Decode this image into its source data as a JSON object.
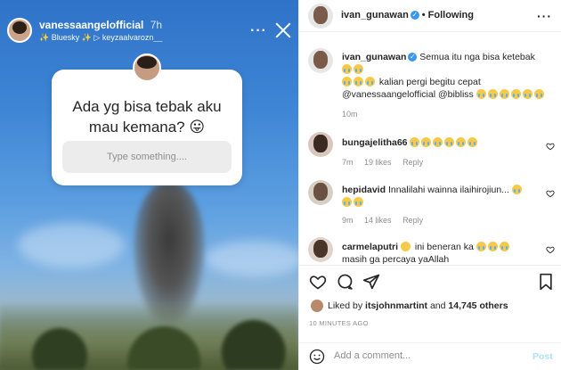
{
  "story": {
    "username": "vanessaangelofficial",
    "time": "7h",
    "music": "✨ Bluesky ✨ ▷ keyzaalvarozn__",
    "more_icon": "more-horizontal-icon",
    "close_icon": "close-icon",
    "question": "Ada yg bisa tebak aku mau kemana? 😛",
    "input_placeholder": "Type something...."
  },
  "post": {
    "author": "ivan_gunawan",
    "following_label": "Following",
    "caption": {
      "username": "ivan_gunawan",
      "text_1": "Semua itu nga bisa ketebak",
      "text_2": "kalian pergi begitu cepat",
      "text_3": "@vanessaangelofficial @bibliss",
      "time": "10m"
    },
    "comments": [
      {
        "username": "bungajelitha66",
        "text": "",
        "time": "7m",
        "likes": "19 likes",
        "reply": "Reply"
      },
      {
        "username": "hepidavid",
        "text": "Innalilahi wainna ilaihirojiun...",
        "time": "9m",
        "likes": "14 likes",
        "reply": "Reply"
      },
      {
        "username": "carmelaputri",
        "text": "ini beneran ka",
        "text_2": "masih ga percaya yaAllah",
        "time": "",
        "likes": "",
        "reply": ""
      }
    ],
    "liked_by": {
      "prefix": "Liked by",
      "user": "itsjohnmartint",
      "and": "and",
      "count": "14,745 others"
    },
    "timestamp": "10 MINUTES AGO",
    "add_comment_placeholder": "Add a comment...",
    "post_button": "Post"
  },
  "colors": {
    "accent": "#3897f0",
    "muted": "#8e8e8e",
    "text": "#262626"
  }
}
